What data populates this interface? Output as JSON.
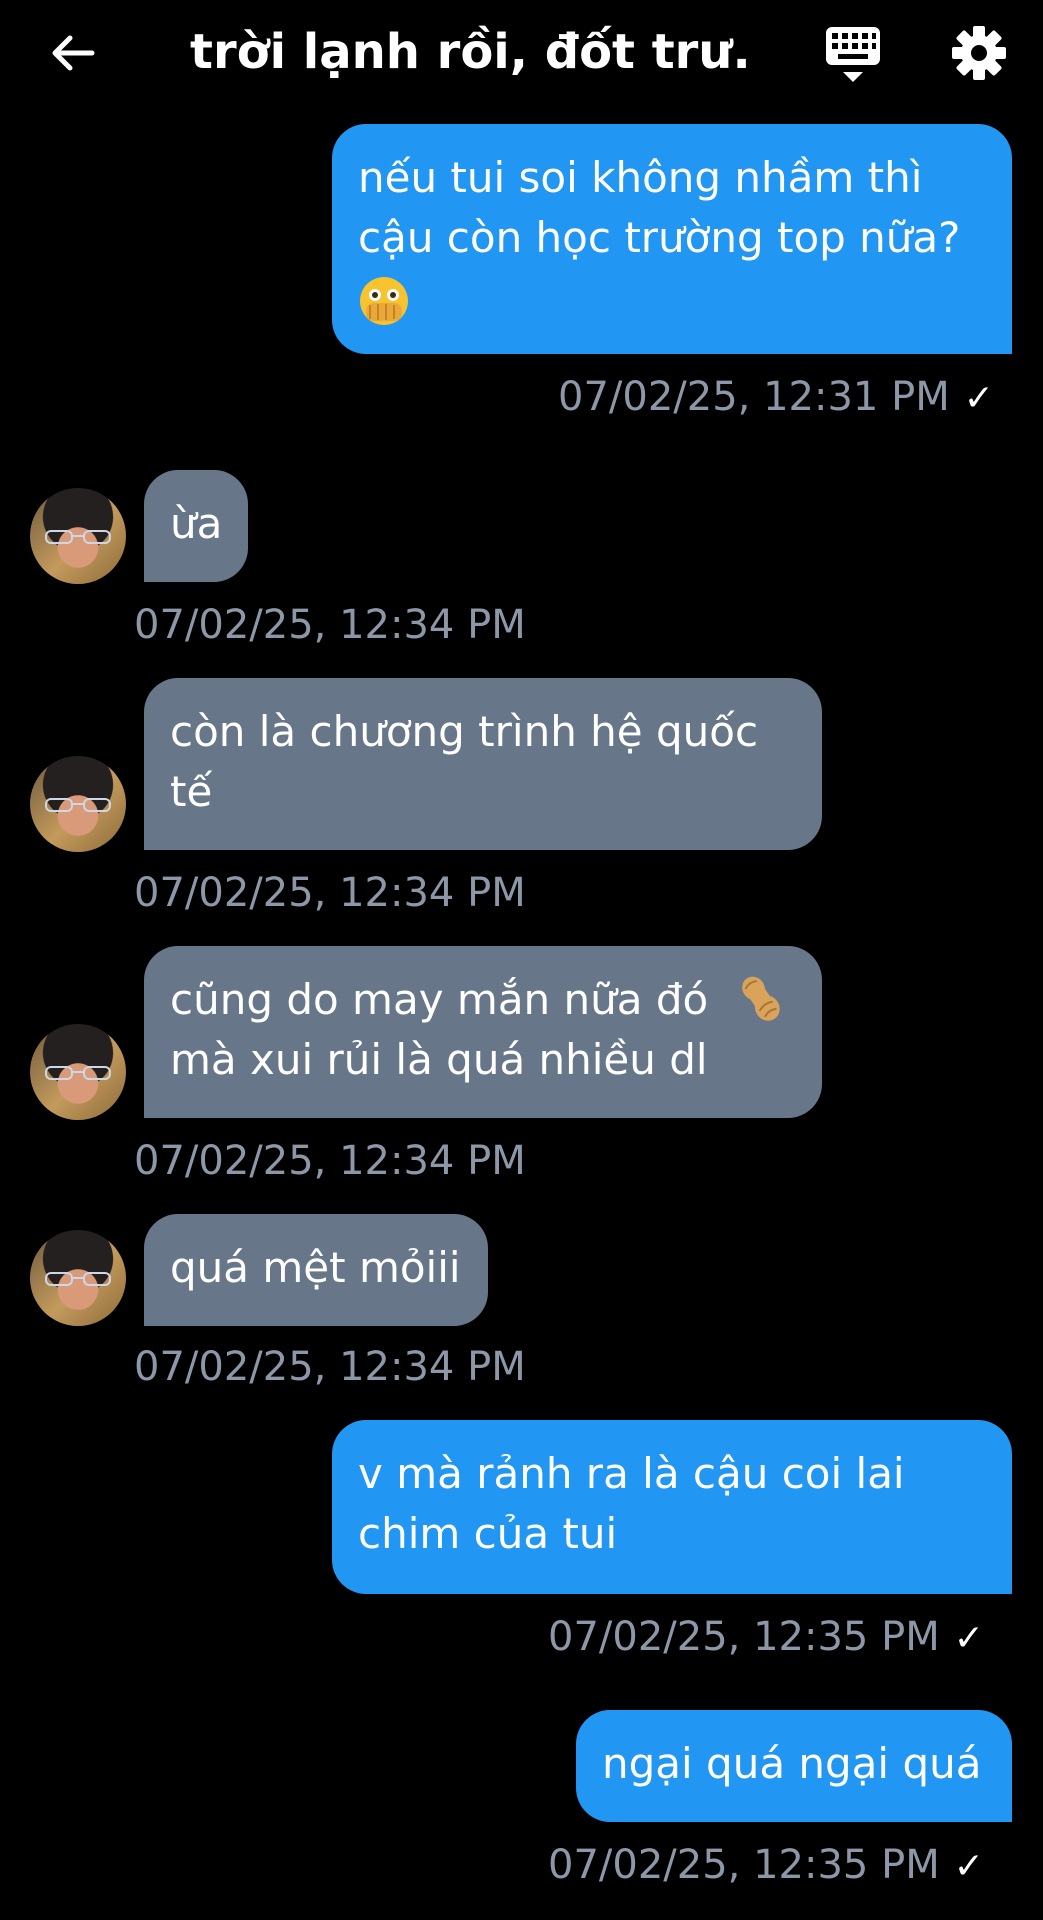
{
  "header": {
    "title": "trời lạnh rồi, đốt trư...",
    "back_icon": "arrow-left-icon",
    "keyboard_icon": "keyboard-icon",
    "settings_icon": "gear-icon"
  },
  "colors": {
    "background": "#000000",
    "outgoing_bubble": "#2196f3",
    "incoming_bubble": "#677789",
    "timestamp": "#8c98a8"
  },
  "messages": [
    {
      "direction": "outgoing",
      "lines": [
        "nếu tui soi không nhầm thì",
        "cậu còn học trường top nữa?"
      ],
      "emoji": "face-with-open-eyes-and-hand-over-mouth-icon",
      "timestamp": "07/02/25, 12:31 PM",
      "read_mark": "✓"
    },
    {
      "direction": "incoming",
      "lines": [
        "ừa"
      ],
      "timestamp": "07/02/25, 12:34 PM"
    },
    {
      "direction": "incoming",
      "lines": [
        "còn là chương trình hệ quốc",
        "tế"
      ],
      "timestamp": "07/02/25, 12:34 PM"
    },
    {
      "direction": "incoming",
      "lines": [
        "cũng do may mắn nữa đó",
        "mà xui rủi là quá nhiều dl"
      ],
      "emoji": "peanut-icon",
      "timestamp": "07/02/25, 12:34 PM"
    },
    {
      "direction": "incoming",
      "lines": [
        "quá mệt mỏiii"
      ],
      "timestamp": "07/02/25, 12:34 PM"
    },
    {
      "direction": "outgoing",
      "lines": [
        "v mà rảnh ra là cậu coi lai",
        "chim của tui"
      ],
      "timestamp": "07/02/25, 12:35 PM",
      "read_mark": "✓"
    },
    {
      "direction": "outgoing",
      "lines": [
        "ngại quá ngại quá"
      ],
      "timestamp": "07/02/25, 12:35 PM",
      "read_mark": "✓"
    }
  ]
}
